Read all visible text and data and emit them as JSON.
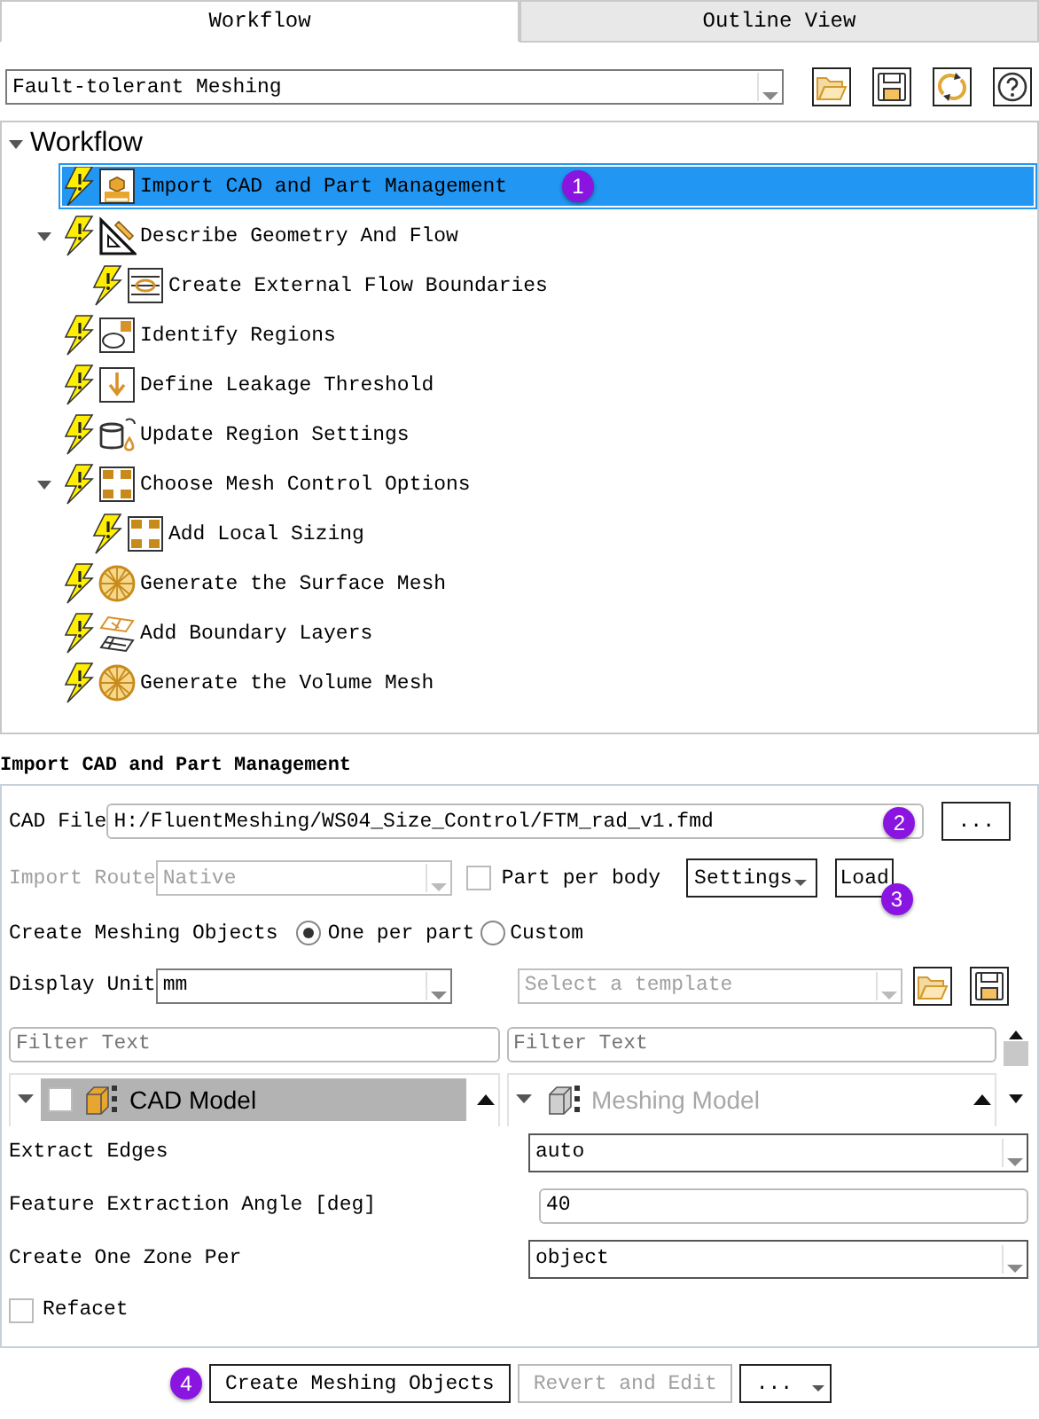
{
  "tabs": [
    {
      "label": "Workflow",
      "selected": true
    },
    {
      "label": "Outline View",
      "selected": false
    }
  ],
  "workflow_select": {
    "value": "Fault-tolerant Meshing"
  },
  "tree": {
    "label": "Workflow",
    "expanded": true,
    "children": [
      {
        "label": "Import CAD and Part Management",
        "kind": "cad",
        "selected": true,
        "callout": "1"
      },
      {
        "label": "Describe Geometry And Flow",
        "kind": "geometry",
        "selected": false,
        "expanded": true,
        "children": [
          {
            "label": "Create External Flow Boundaries",
            "kind": "flow-boundaries",
            "selected": false
          }
        ]
      },
      {
        "label": "Identify Regions",
        "kind": "regions",
        "selected": false
      },
      {
        "label": "Define Leakage Threshold",
        "kind": "leakage",
        "selected": false
      },
      {
        "label": "Update Region Settings",
        "kind": "update",
        "selected": false
      },
      {
        "label": "Choose Mesh Control Options",
        "kind": "mesh-control",
        "selected": false,
        "expanded": true,
        "children": [
          {
            "label": "Add Local Sizing",
            "kind": "mesh-control",
            "selected": false
          }
        ]
      },
      {
        "label": "Generate the Surface Mesh",
        "kind": "sphere-mesh",
        "selected": false
      },
      {
        "label": "Add Boundary Layers",
        "kind": "layers",
        "selected": false
      },
      {
        "label": "Generate the Volume Mesh",
        "kind": "sphere-mesh",
        "selected": false
      }
    ]
  },
  "panel": {
    "title": "Import CAD and Part Management",
    "cad_file": {
      "label": "CAD File",
      "value": "H:/FluentMeshing/WS04_Size_Control/FTM_rad_v1.fmd",
      "browse": "...",
      "callout": "2"
    },
    "import_route": {
      "label": "Import Route",
      "value": "Native",
      "disabled": true
    },
    "part_per_body": {
      "label": "Part per body",
      "checked": false
    },
    "settings_button": {
      "label": "Settings"
    },
    "load_button": {
      "label": "Load",
      "callout": "3"
    },
    "create_meshing_objects": {
      "label": "Create Meshing Objects",
      "options": [
        {
          "label": "One per part",
          "selected": true
        },
        {
          "label": "Custom",
          "selected": false
        }
      ]
    },
    "display_unit": {
      "label": "Display Unit",
      "value": "mm"
    },
    "template": {
      "placeholder": "Select a template",
      "disabled": true
    },
    "filters": [
      {
        "placeholder": "Filter Text"
      },
      {
        "placeholder": "Filter Text"
      }
    ],
    "models": [
      {
        "label": "CAD Model",
        "kind": "cad",
        "selected": true,
        "disabled": false,
        "checked": false
      },
      {
        "label": "Meshing Model",
        "kind": "meshing",
        "selected": false,
        "disabled": true
      }
    ],
    "fields": [
      {
        "kind": "select",
        "label": "Extract Edges",
        "value": "auto"
      },
      {
        "kind": "text",
        "label": "Feature Extraction Angle [deg]",
        "value": "40"
      },
      {
        "kind": "select",
        "label": "Create One Zone Per",
        "value": "object"
      }
    ],
    "refacet": {
      "label": "Refacet",
      "checked": false
    }
  },
  "actions": [
    {
      "kind": "button",
      "label": "Create Meshing Objects",
      "disabled": false,
      "callout": "4"
    },
    {
      "kind": "button",
      "label": "Revert and Edit",
      "disabled": true
    },
    {
      "kind": "menu",
      "label": "..."
    }
  ]
}
